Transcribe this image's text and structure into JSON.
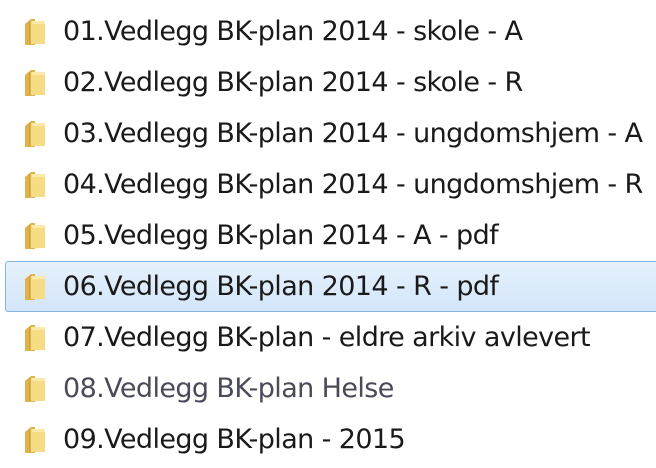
{
  "folders": [
    {
      "label": "01.Vedlegg BK-plan 2014 - skole - A",
      "icon": "folder-icon",
      "selected": false
    },
    {
      "label": "02.Vedlegg BK-plan 2014 - skole - R",
      "icon": "folder-icon",
      "selected": false
    },
    {
      "label": "03.Vedlegg BK-plan 2014 - ungdomshjem - A",
      "icon": "folder-icon",
      "selected": false
    },
    {
      "label": "04.Vedlegg BK-plan 2014 - ungdomshjem - R",
      "icon": "folder-icon",
      "selected": false
    },
    {
      "label": "05.Vedlegg BK-plan 2014 - A - pdf",
      "icon": "folder-icon",
      "selected": false
    },
    {
      "label": "06.Vedlegg BK-plan 2014 - R - pdf",
      "icon": "folder-icon",
      "selected": true
    },
    {
      "label": "07.Vedlegg BK-plan - eldre arkiv avlevert",
      "icon": "folder-icon",
      "selected": false
    },
    {
      "label": "08.Vedlegg BK-plan Helse",
      "icon": "folder-icon",
      "selected": false
    },
    {
      "label": "09.Vedlegg BK-plan - 2015",
      "icon": "folder-icon",
      "selected": false
    }
  ],
  "colors": {
    "folder_light": "#f6d77c",
    "folder_dark": "#d9a93a",
    "selection_border": "#88b3e2",
    "selection_fill": "#d9ebfb"
  }
}
